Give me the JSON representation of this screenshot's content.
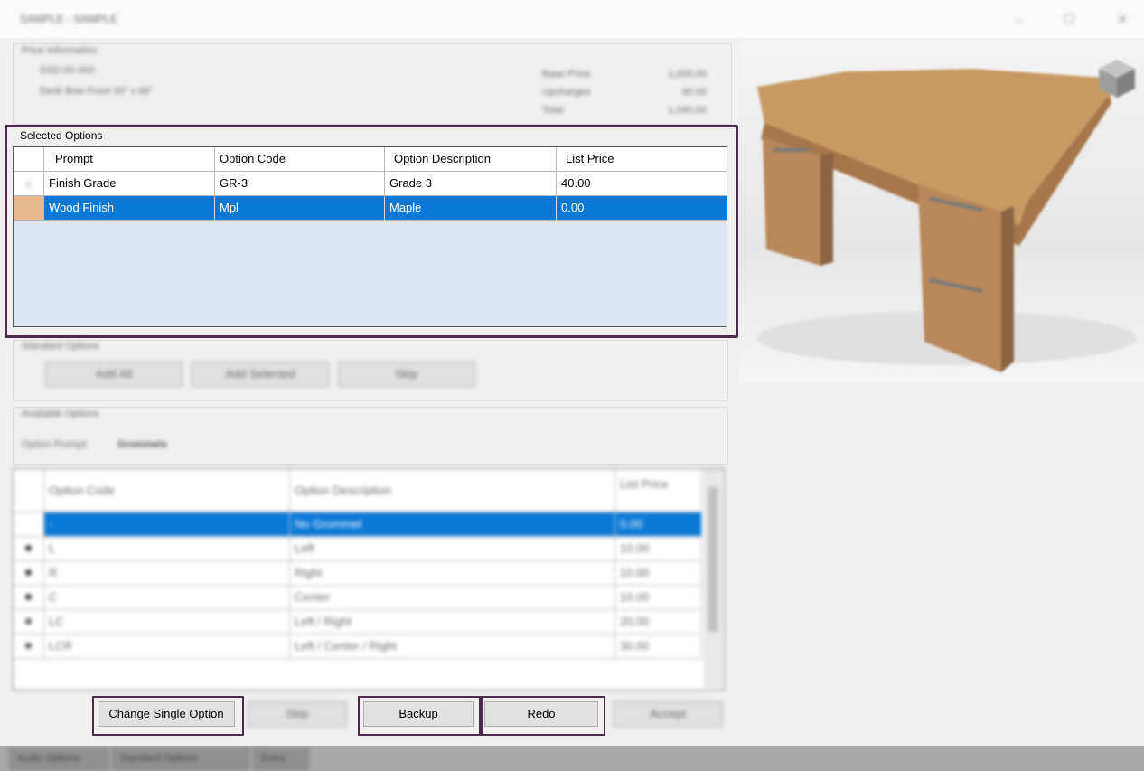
{
  "window": {
    "title": "SAMPLE - SAMPLE",
    "controls": [
      "–",
      "☐",
      "✕"
    ]
  },
  "price_info": {
    "group_label": "Price Information",
    "part_number": "SSD-00-000",
    "description": "Desk Bow Front 30\" x 66\"",
    "rows": [
      {
        "label": "Base Price",
        "value": "1,000.00"
      },
      {
        "label": "Upcharges",
        "value": "40.00"
      },
      {
        "label": "Total",
        "value": "1,040.00"
      }
    ]
  },
  "selected_options": {
    "group_label": "Selected Options",
    "columns": [
      "Prompt",
      "Option Code",
      "Option Description",
      "List Price"
    ],
    "rows": [
      {
        "prompt": "Finish Grade",
        "code": "GR-3",
        "description": "Grade 3",
        "price": "40.00",
        "selected": false
      },
      {
        "prompt": "Wood Finish",
        "code": "Mpl",
        "description": "Maple",
        "price": "0.00",
        "selected": true
      }
    ]
  },
  "standard_options": {
    "group_label": "Standard Options",
    "buttons": [
      "Add All",
      "Add Selected",
      "Skip"
    ]
  },
  "available_options": {
    "group_label": "Available Options",
    "prompt_label": "Option Prompt:",
    "prompt_value": "Grommets",
    "columns": [
      "Option Code",
      "Option Description",
      "List Price"
    ],
    "rows": [
      {
        "code": "-",
        "description": "No Grommet",
        "price": "0.00",
        "selected": true
      },
      {
        "code": "L",
        "description": "Left",
        "price": "10.00",
        "selected": false
      },
      {
        "code": "R",
        "description": "Right",
        "price": "10.00",
        "selected": false
      },
      {
        "code": "C",
        "description": "Center",
        "price": "10.00",
        "selected": false
      },
      {
        "code": "LC",
        "description": "Left / Right",
        "price": "20.00",
        "selected": false
      },
      {
        "code": "LCR",
        "description": "Left / Center / Right",
        "price": "30.00",
        "selected": false
      }
    ]
  },
  "actions": {
    "change_single_option": "Change Single Option",
    "skip": "Skip",
    "backup": "Backup",
    "redo": "Redo",
    "accept": "Accept"
  },
  "bottom_tabs": [
    "Audio Options",
    "Standard Options",
    "Extra"
  ],
  "colors": {
    "selection": "#0a78d7",
    "highlight_border": "#4a2b4a",
    "grid_background": "#dce6f0"
  }
}
